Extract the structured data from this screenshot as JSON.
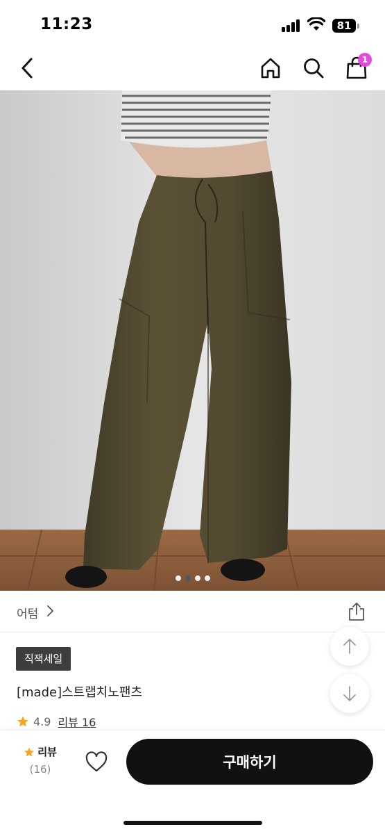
{
  "status_bar": {
    "time": "11:23",
    "battery": "81"
  },
  "nav": {
    "icons": [
      "back-icon",
      "home-icon",
      "search-icon",
      "shopping-bag-icon"
    ],
    "cart_count": "1",
    "badge_color": "#e24bd9"
  },
  "carousel": {
    "total_images": 4,
    "active_index": 1
  },
  "brand": {
    "name": "어텀"
  },
  "product": {
    "sale_badge": "직잭세일",
    "title": "[made]스트랩치노팬츠",
    "rating": "4.9",
    "review_link": "리뷰 16"
  },
  "bottom_bar": {
    "review_label": "리뷰",
    "review_count": "(16)",
    "buy_label": "구매하기",
    "buy_color": "#111111",
    "star_color": "#f5a623"
  }
}
